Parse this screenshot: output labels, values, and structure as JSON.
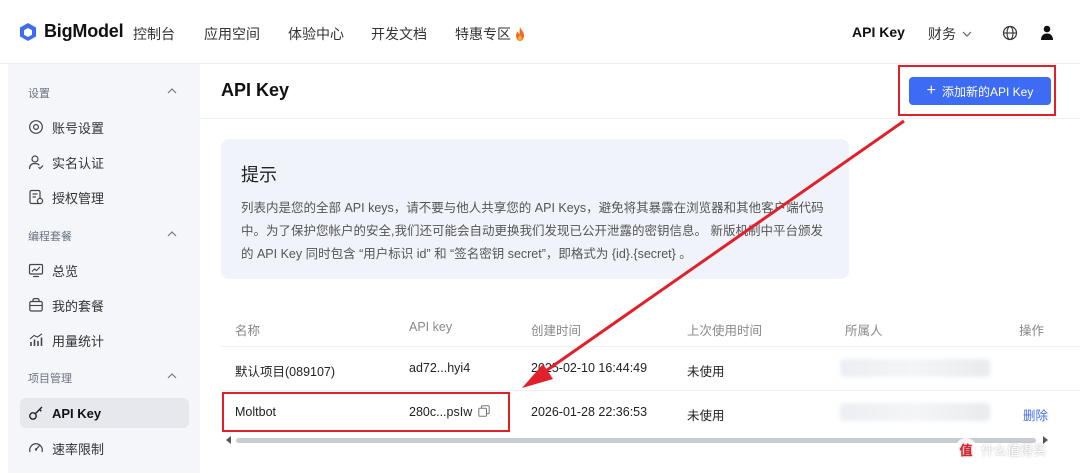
{
  "app": {
    "logo_text": "BigModel"
  },
  "topnav": {
    "items": [
      {
        "label": "控制台"
      },
      {
        "label": "应用空间"
      },
      {
        "label": "体验中心"
      },
      {
        "label": "开发文档"
      },
      {
        "label": "特惠专区"
      }
    ],
    "api_key_label": "API Key",
    "finance_label": "财务"
  },
  "sidebar": {
    "groups": [
      {
        "title": "设置",
        "items": [
          {
            "label": "账号设置",
            "icon": "gear-icon"
          },
          {
            "label": "实名认证",
            "icon": "user-verify-icon"
          },
          {
            "label": "授权管理",
            "icon": "authorization-icon"
          }
        ]
      },
      {
        "title": "编程套餐",
        "items": [
          {
            "label": "总览",
            "icon": "overview-icon"
          },
          {
            "label": "我的套餐",
            "icon": "package-icon"
          },
          {
            "label": "用量统计",
            "icon": "usage-chart-icon"
          }
        ]
      },
      {
        "title": "项目管理",
        "items": [
          {
            "label": "API Key",
            "icon": "key-icon",
            "active": true
          },
          {
            "label": "速率限制",
            "icon": "rate-limit-icon"
          }
        ]
      }
    ]
  },
  "main": {
    "title": "API Key",
    "add_button_label": "添加新的API Key",
    "notice": {
      "title": "提示",
      "text": "列表内是您的全部 API keys，请不要与他人共享您的 API Keys，避免将其暴露在浏览器和其他客户端代码中。为了保护您帐户的安全,我们还可能会自动更换我们发现已公开泄露的密钥信息。 新版机制中平台颁发的 API Key 同时包含 “用户标识 id” 和 “签名密钥 secret”，即格式为 {id}.{secret} 。"
    },
    "table": {
      "headers": [
        "名称",
        "API key",
        "创建时间",
        "上次使用时间",
        "所属人",
        "操作"
      ],
      "rows": [
        {
          "name": "默认项目(089107)",
          "key": "ad72...hyi4",
          "created": "2025-02-10 16:44:49",
          "last_used": "未使用",
          "action": ""
        },
        {
          "name": "Moltbot",
          "key": "280c...psIw",
          "created": "2026-01-28 22:36:53",
          "last_used": "未使用",
          "action": "删除"
        }
      ]
    }
  },
  "watermark": {
    "badge": "值",
    "text": "什么值得买"
  },
  "colors": {
    "accent": "#3e6bf4",
    "highlight": "#e0212c",
    "sidebar_bg": "#f5f6f9",
    "notice_bg": "#f0f3fa"
  }
}
